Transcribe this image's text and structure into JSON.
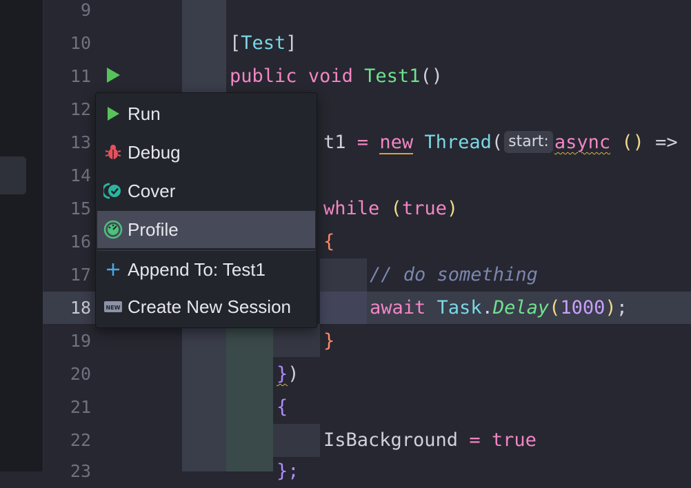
{
  "editor": {
    "line_numbers": [
      "9",
      "10",
      "11",
      "12",
      "13",
      "14",
      "15",
      "16",
      "17",
      "18",
      "19",
      "20",
      "21",
      "22",
      "23"
    ],
    "active_line": "18",
    "code": {
      "l10_open": "[",
      "l10_attr": "Test",
      "l10_close": "]",
      "l11_public": "public",
      "l11_void": "void",
      "l11_name": "Test1",
      "l11_paren_open": "(",
      "l11_paren_close": ")",
      "l13_var": "t1",
      "l13_eq": "=",
      "l13_new": "new",
      "l13_type": "Thread",
      "l13_paren": "(",
      "l13_hint": "start:",
      "l13_async": "async",
      "l13_lambda_parens": "()",
      "l13_arrow": "=>",
      "l15_while": "while",
      "l15_paren_open": "(",
      "l15_true": "true",
      "l15_paren_close": ")",
      "l16_brace": "{",
      "l17_comment": "// do something",
      "l18_await": "await",
      "l18_task": "Task",
      "l18_dot": ".",
      "l18_delay": "Delay",
      "l18_paren_open": "(",
      "l18_num": "1000",
      "l18_paren_close": ")",
      "l18_semi": ";",
      "l19_brace": "}",
      "l20_brace": "}",
      "l20_paren": ")",
      "l21_brace": "{",
      "l22_prop": "IsBackground",
      "l22_eq": "=",
      "l22_true": "true",
      "l23_partial": "};"
    }
  },
  "run_menu": {
    "items": [
      {
        "label": "Run",
        "icon": "run-icon"
      },
      {
        "label": "Debug",
        "icon": "debug-bug-icon"
      },
      {
        "label": "Cover",
        "icon": "coverage-icon"
      },
      {
        "label": "Profile",
        "icon": "profiler-gauge-icon",
        "selected": true
      }
    ],
    "session_items": [
      {
        "label": "Append To: Test1",
        "icon": "plus-icon"
      },
      {
        "label": "Create New Session",
        "icon": "new-badge-icon"
      }
    ]
  },
  "colors": {
    "background": "#262730",
    "keyword": "#f286c4",
    "type": "#7ad8e6",
    "method": "#6fe28f",
    "number": "#c8a0ff",
    "comment": "#7b86b0",
    "run_green": "#57c25a",
    "debug_red": "#e8505b",
    "cover_teal": "#2bb5a0",
    "menu_selected": "#474a59"
  }
}
